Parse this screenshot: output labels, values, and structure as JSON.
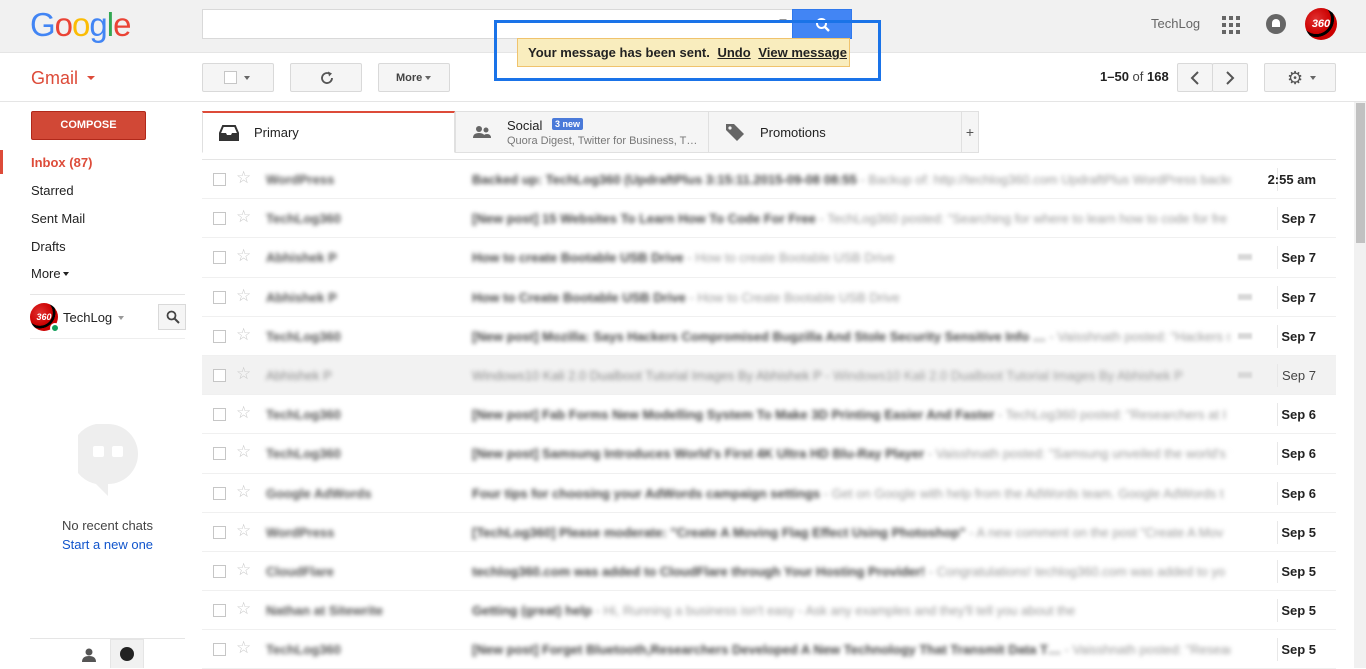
{
  "header": {
    "logo": "Google",
    "account_name": "TechLog",
    "avatar_text": "360",
    "search": {
      "placeholder": "",
      "value": ""
    }
  },
  "notification": {
    "message": "Your message has been sent.",
    "undo": "Undo",
    "view": "View message"
  },
  "toolbar": {
    "app_label": "Gmail",
    "more_label": "More",
    "pagination_range": "1–50",
    "pagination_of": "of",
    "pagination_total": "168"
  },
  "sidebar": {
    "compose_label": "COMPOSE",
    "items": [
      {
        "label": "Inbox (87)"
      },
      {
        "label": "Starred"
      },
      {
        "label": "Sent Mail"
      },
      {
        "label": "Drafts"
      },
      {
        "label": "More"
      }
    ],
    "chat_user": "TechLog",
    "no_chats": "No recent chats",
    "start_new": "Start a new one"
  },
  "tabs": [
    {
      "label": "Primary"
    },
    {
      "label": "Social",
      "badge": "3 new",
      "subtitle": "Quora Digest, Twitter for Business, T…"
    },
    {
      "label": "Promotions"
    }
  ],
  "messages": [
    {
      "sender": "WordPress",
      "subject": "Backed up: TechLog360 (UpdraftPlus 3:15:11.2015-09-08 08:55",
      "snippet": "- Backup of: http://techlog360.com UpdraftPlus WordPress backup",
      "date": "2:55 am",
      "read": false
    },
    {
      "sender": "TechLog360",
      "subject": "[New post] 15 Websites To Learn How To Code For Free",
      "snippet": "- TechLog360 posted: \"Searching for where to learn how to code for fre",
      "date": "Sep 7",
      "read": false
    },
    {
      "sender": "Abhishek P",
      "subject": "How to create Bootable USB Drive",
      "snippet": "- How to create Bootable USB Drive",
      "date": "Sep 7",
      "read": false
    },
    {
      "sender": "Abhishek P",
      "subject": "How to Create Bootable USB Drive",
      "snippet": "- How to Create Bootable USB Drive",
      "date": "Sep 7",
      "read": false
    },
    {
      "sender": "TechLog360",
      "subject": "[New post] Mozilla: Says Hackers Compromised Bugzilla And Stole Security Sensitive Info …",
      "snippet": "- Vaisshnath posted: \"Hackers s",
      "date": "Sep 7",
      "read": false
    },
    {
      "sender": "Abhishek P",
      "subject": "Windows10 Kali 2.0 Dualboot Tutorial Images By Abhishek P",
      "snippet": "- Windows10 Kali 2.0 Dualboot Tutorial Images By Abhishek P",
      "date": "Sep 7",
      "read": true
    },
    {
      "sender": "TechLog360",
      "subject": "[New post] Fab Forms New Modelling System To Make 3D Printing Easier And Faster",
      "snippet": "- TechLog360 posted: \"Researchers at I",
      "date": "Sep 6",
      "read": false
    },
    {
      "sender": "TechLog360",
      "subject": "[New post] Samsung Introduces World's First 4K Ultra HD Blu-Ray Player",
      "snippet": "- Vaisshnath posted: \"Samsung unveiled the world's f",
      "date": "Sep 6",
      "read": false
    },
    {
      "sender": "Google AdWords",
      "subject": "Four tips for choosing your AdWords campaign settings",
      "snippet": "- Get on Google with help from the AdWords team. Google AdWords t",
      "date": "Sep 6",
      "read": false
    },
    {
      "sender": "WordPress",
      "subject": "[TechLog360] Please moderate: \"Create A Moving Flag Effect Using Photoshop\"",
      "snippet": "- A new comment on the post \"Create A Mov",
      "date": "Sep 5",
      "read": false
    },
    {
      "sender": "CloudFlare",
      "subject": "techlog360.com was added to CloudFlare through Your Hosting Provider!",
      "snippet": "- Congratulations! techlog360.com was added to yo",
      "date": "Sep 5",
      "read": false
    },
    {
      "sender": "Nathan at Sitewrite",
      "subject": "Getting (great) help",
      "snippet": "- Hi, Running a business isn't easy - Ask any examples and they'll tell you about the",
      "date": "Sep 5",
      "read": false
    },
    {
      "sender": "TechLog360",
      "subject": "[New post] Forget Bluetooth,Researchers Developed A New Technology That Transmit Data T…",
      "snippet": "- Vaisshnath posted: \"Researc",
      "date": "Sep 5",
      "read": false
    }
  ],
  "colors": {
    "accent_red": "#dd4b39",
    "compose_red": "#d14836",
    "google_blue": "#4285f4",
    "notify_yellow": "#f9edbe",
    "highlight_frame": "#1a73e8",
    "link_blue": "#15c"
  }
}
